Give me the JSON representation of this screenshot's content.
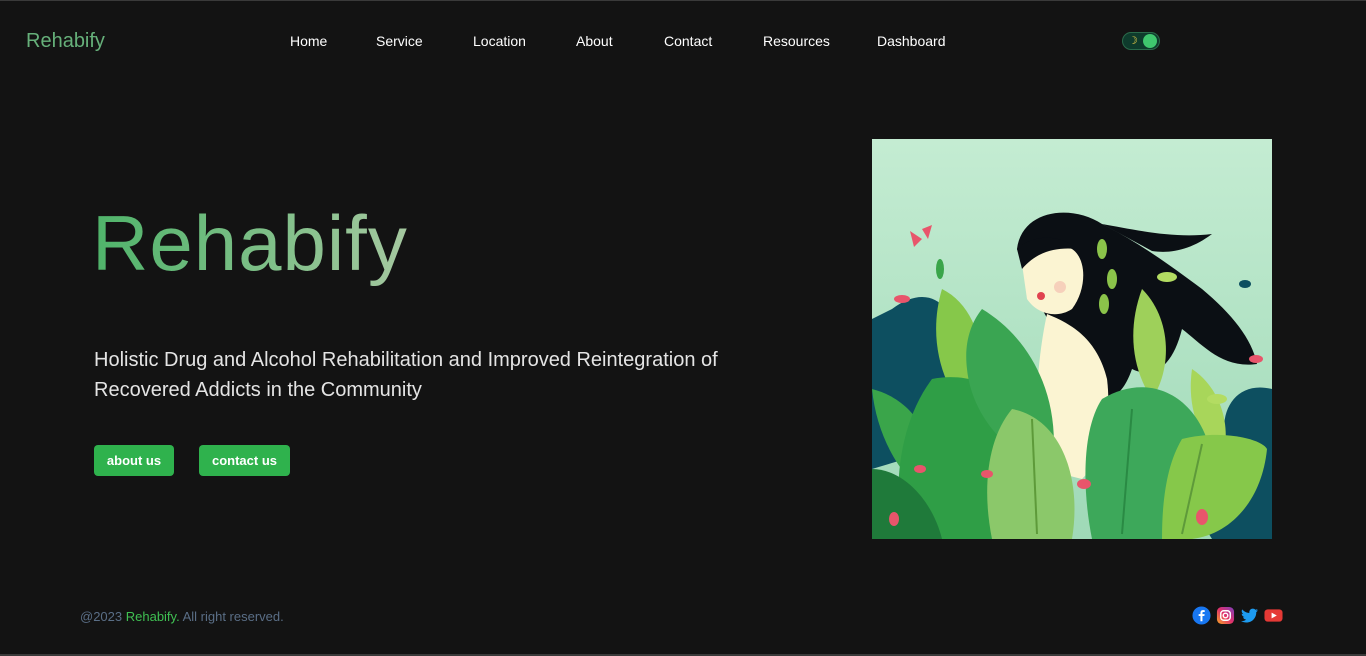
{
  "header": {
    "logo": "Rehabify",
    "nav": [
      "Home",
      "Service",
      "Location",
      "About",
      "Contact",
      "Resources",
      "Dashboard"
    ],
    "theme_toggle": {
      "icon": "moon-icon",
      "state": "dark"
    }
  },
  "hero": {
    "title": "Rehabify",
    "subtitle": "Holistic Drug and Alcohol Rehabilitation and Improved Reintegration of Recovered Addicts in the Community",
    "buttons": {
      "about": "about us",
      "contact": "contact us"
    },
    "image": "woman-in-leaves-illustration"
  },
  "footer": {
    "copyright_prefix": "@2023 ",
    "brand": "Rehabify.",
    "copyright_suffix": " All right reserved.",
    "socials": [
      "facebook-icon",
      "instagram-icon",
      "twitter-icon",
      "youtube-icon"
    ]
  },
  "colors": {
    "background": "#131313",
    "accent": "#2fb24d",
    "logo": "#66b07a",
    "footer_text": "#5a6e86"
  }
}
